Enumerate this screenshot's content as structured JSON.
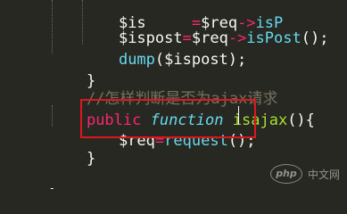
{
  "code": {
    "line1": "$ispost=$req->isPost();",
    "line2_fn": "dump",
    "line2_arg": "($ispost);",
    "line3": "}",
    "line4_comment": "//怎样判断是否为ajax请求",
    "line5_public": "public",
    "line5_function": "function",
    "line5_name": "isajax",
    "line5_rest": "(){",
    "line6_var": "$req",
    "line6_eq": "=",
    "line6_call": "request",
    "line6_rest": "();",
    "line7": "}",
    "line9": "}"
  },
  "watermark": {
    "logo": "php",
    "text": "中文网"
  },
  "colors": {
    "background": "#272822",
    "highlight_box": "#e0161e"
  }
}
